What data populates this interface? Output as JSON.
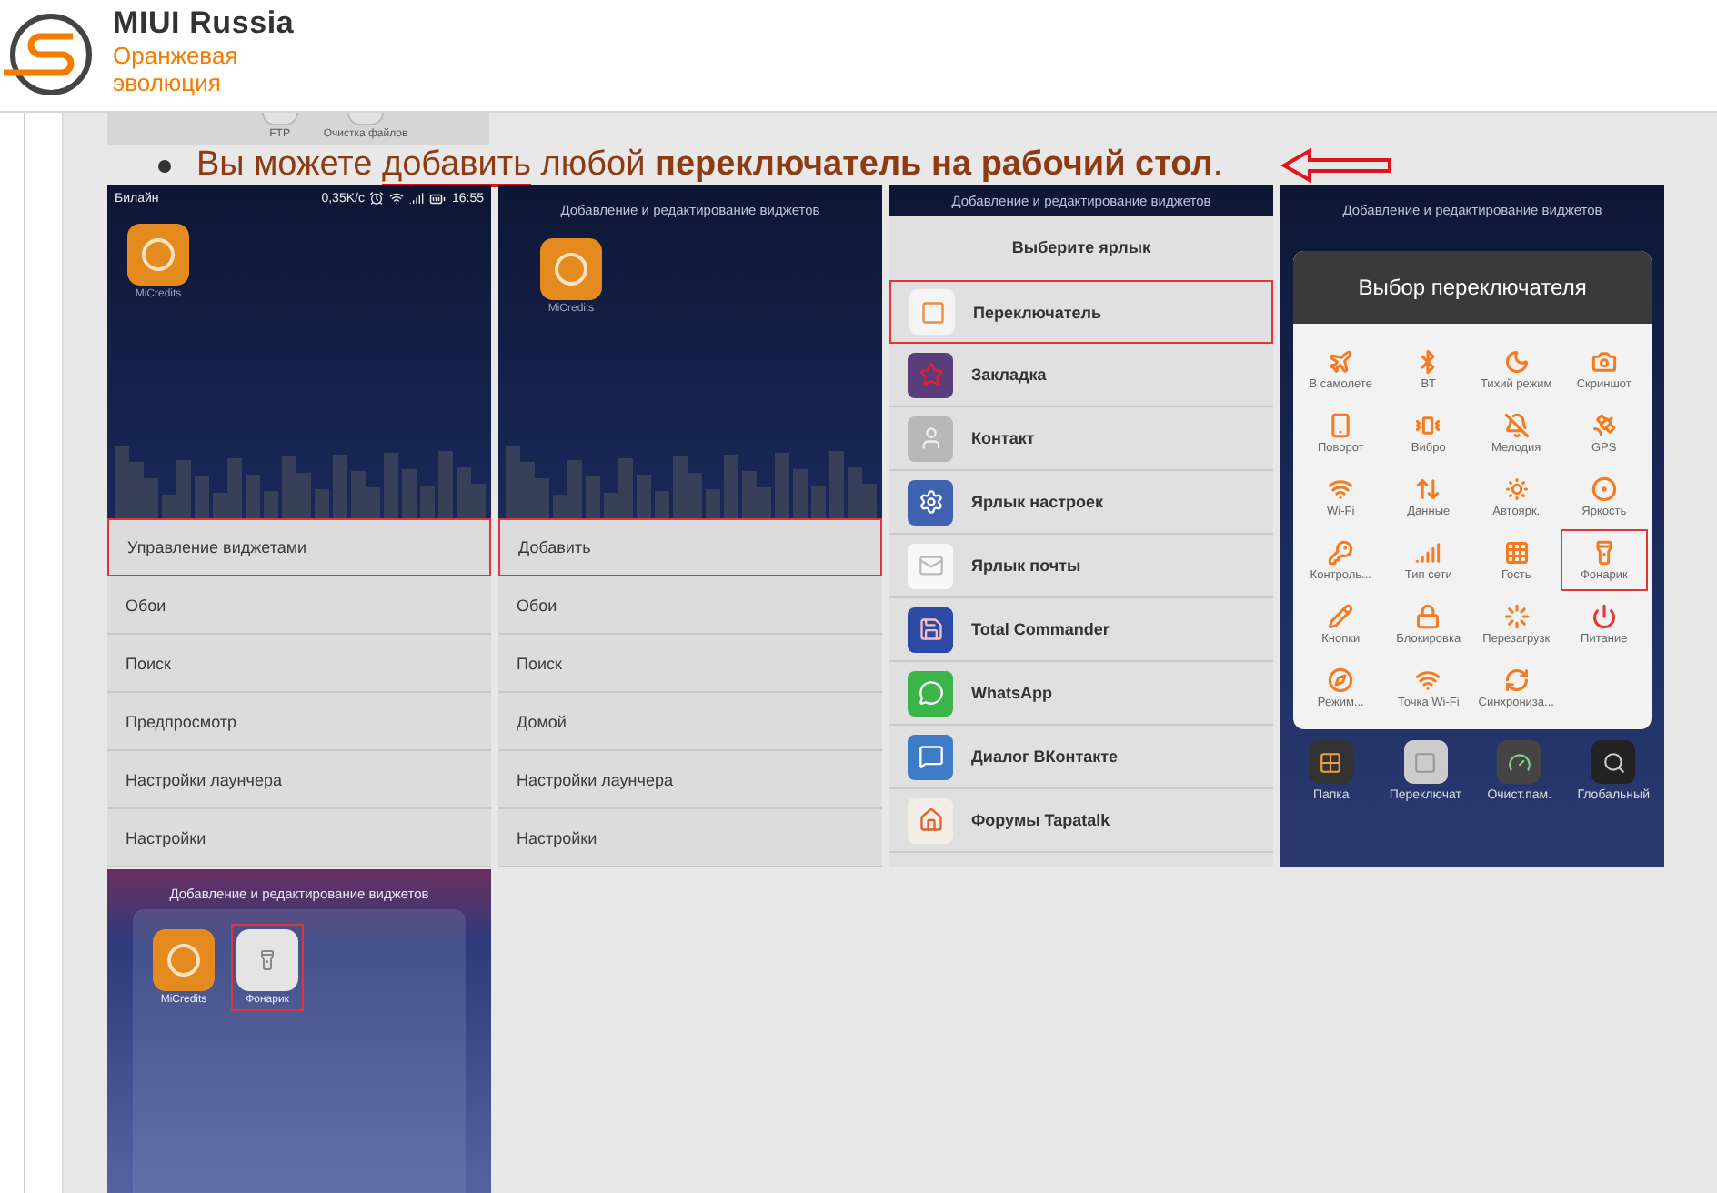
{
  "header": {
    "site_name": "MIUI Russia",
    "tagline": "Оранжевая эволюция"
  },
  "previous_image": {
    "labels": [
      "FTP",
      "Очистка файлов"
    ]
  },
  "bullet": {
    "parts": [
      {
        "text": "Вы можете ",
        "underlined": false
      },
      {
        "text": "добавить",
        "underlined": true
      },
      {
        "text": " любой **переключатель на рабочий стол**.",
        "underlined": false
      }
    ]
  },
  "screenshots": [
    {
      "kind": "menu",
      "status_bar": {
        "carrier": "Билайн",
        "speed": "0,35K/c",
        "time": "16:55"
      },
      "app_label": "MiCredits",
      "menu": [
        {
          "label": "Управление виджетами",
          "selected": true
        },
        {
          "label": "Обои",
          "selected": false
        },
        {
          "label": "Поиск",
          "selected": false
        },
        {
          "label": "Предпросмотр",
          "selected": false
        },
        {
          "label": "Настройки лаунчера",
          "selected": false
        },
        {
          "label": "Настройки",
          "selected": false
        }
      ]
    },
    {
      "kind": "menu",
      "title": "Добавление и редактирование виджетов",
      "app_label": "MiCredits",
      "menu": [
        {
          "label": "Добавить",
          "selected": true
        },
        {
          "label": "Обои",
          "selected": false
        },
        {
          "label": "Поиск",
          "selected": false
        },
        {
          "label": "Домой",
          "selected": false
        },
        {
          "label": "Настройки лаунчера",
          "selected": false
        },
        {
          "label": "Настройки",
          "selected": false
        }
      ]
    },
    {
      "kind": "shortcuts",
      "title": "Добавление и редактирование виджетов",
      "dialog_title": "Выберите ярлык",
      "items": [
        {
          "label": "Переключатель",
          "selected": true
        },
        {
          "label": "Закладка",
          "selected": false
        },
        {
          "label": "Контакт",
          "selected": false
        },
        {
          "label": "Ярлык настроек",
          "selected": false
        },
        {
          "label": "Ярлык почты",
          "selected": false
        },
        {
          "label": "Total Commander",
          "selected": false
        },
        {
          "label": "WhatsApp",
          "selected": false
        },
        {
          "label": "Диалог ВКонтакте",
          "selected": false
        },
        {
          "label": "Форумы Tapatalk",
          "selected": false
        }
      ]
    },
    {
      "kind": "toggles",
      "title": "Добавление и редактирование виджетов",
      "dialog_title": "Выбор переключателя",
      "toggles": [
        {
          "label": "В самолете",
          "selected": false
        },
        {
          "label": "BT",
          "selected": false
        },
        {
          "label": "Тихий режим",
          "selected": false
        },
        {
          "label": "Скриншот",
          "selected": false
        },
        {
          "label": "Поворот",
          "selected": false
        },
        {
          "label": "Вибро",
          "selected": false
        },
        {
          "label": "Мелодия",
          "selected": false
        },
        {
          "label": "GPS",
          "selected": false
        },
        {
          "label": "Wi-Fi",
          "selected": false
        },
        {
          "label": "Данные",
          "selected": false
        },
        {
          "label": "Автоярк.",
          "selected": false
        },
        {
          "label": "Яркость",
          "selected": false
        },
        {
          "label": "Контроль...",
          "selected": false
        },
        {
          "label": "Тип сети",
          "selected": false
        },
        {
          "label": "Гость",
          "selected": false
        },
        {
          "label": "Фонарик",
          "selected": true
        },
        {
          "label": "Кнопки",
          "selected": false
        },
        {
          "label": "Блокировка",
          "selected": false
        },
        {
          "label": "Перезагрузк",
          "selected": false
        },
        {
          "label": "Питание",
          "selected": false
        },
        {
          "label": "Режим...",
          "selected": false
        },
        {
          "label": "Точка Wi-Fi",
          "selected": false
        },
        {
          "label": "Синхрониза...",
          "selected": false
        }
      ],
      "dock": [
        "Папка",
        "Переключат",
        "Очист.пам.",
        "Глобальный"
      ]
    },
    {
      "kind": "home",
      "title": "Добавление и редактирование виджетов",
      "apps": [
        {
          "label": "MiCredits",
          "selected": false
        },
        {
          "label": "Фонарик",
          "selected": true
        }
      ]
    }
  ]
}
